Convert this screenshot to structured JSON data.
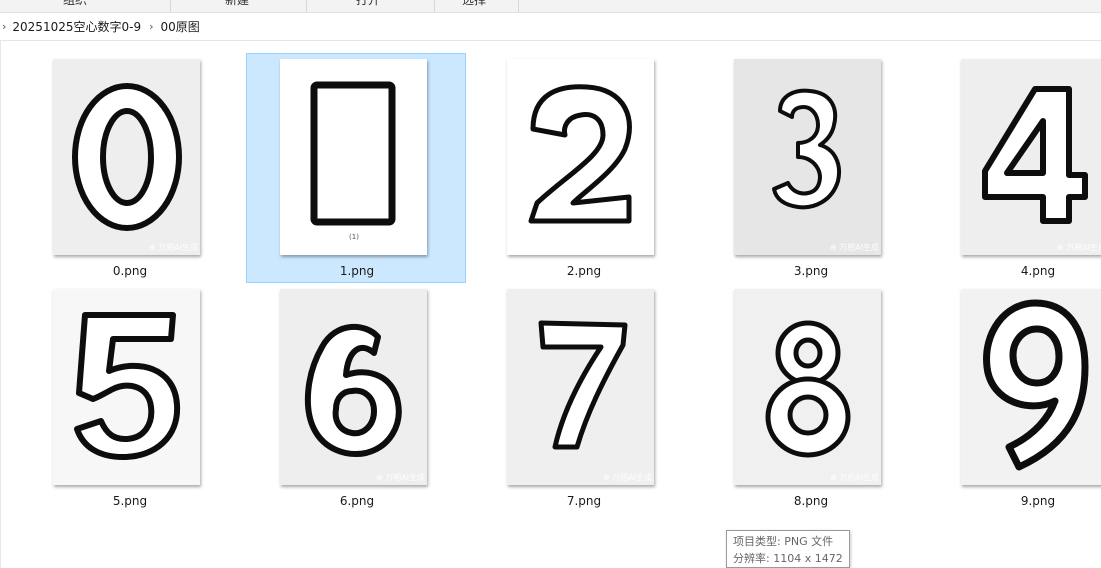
{
  "ribbon": {
    "groups": [
      {
        "label": "组织"
      },
      {
        "label": "新建"
      },
      {
        "label": "打开"
      },
      {
        "label": "选择"
      }
    ]
  },
  "breadcrumb": {
    "separator": "›",
    "items": [
      "20251025空心数字0-9",
      "00原图"
    ]
  },
  "files": [
    {
      "name": "0.png",
      "digit": "0",
      "selected": false,
      "bg": "#eeeeee",
      "watermark": "⊕ 万相AI生成"
    },
    {
      "name": "1.png",
      "digit": "1",
      "selected": true,
      "bg": "#ffffff",
      "watermark": ""
    },
    {
      "name": "2.png",
      "digit": "2",
      "selected": false,
      "bg": "#ffffff",
      "watermark": ""
    },
    {
      "name": "3.png",
      "digit": "3",
      "selected": false,
      "bg": "#e6e6e6",
      "watermark": "⊕ 万相AI生成"
    },
    {
      "name": "4.png",
      "digit": "4",
      "selected": false,
      "bg": "#eeeeee",
      "watermark": "⊕ 万相AI生成"
    },
    {
      "name": "5.png",
      "digit": "5",
      "selected": false,
      "bg": "#f7f7f7",
      "watermark": ""
    },
    {
      "name": "6.png",
      "digit": "6",
      "selected": false,
      "bg": "#eeeeee",
      "watermark": "⊕ 万相AI生成"
    },
    {
      "name": "7.png",
      "digit": "7",
      "selected": false,
      "bg": "#efefef",
      "watermark": "⊕ 万相AI生成"
    },
    {
      "name": "8.png",
      "digit": "8",
      "selected": false,
      "bg": "#f0f0f0",
      "watermark": "⊕ 万相AI生成"
    },
    {
      "name": "9.png",
      "digit": "9",
      "selected": false,
      "bg": "#f2f2f2",
      "watermark": ""
    }
  ],
  "tooltip": {
    "type_line": "项目类型: PNG 文件",
    "resolution_line": "分辨率: 1104 x 1472"
  },
  "colors": {
    "selection_bg": "#cce8ff",
    "selection_border": "#99d1ff",
    "outline": "#0d0d0d"
  }
}
